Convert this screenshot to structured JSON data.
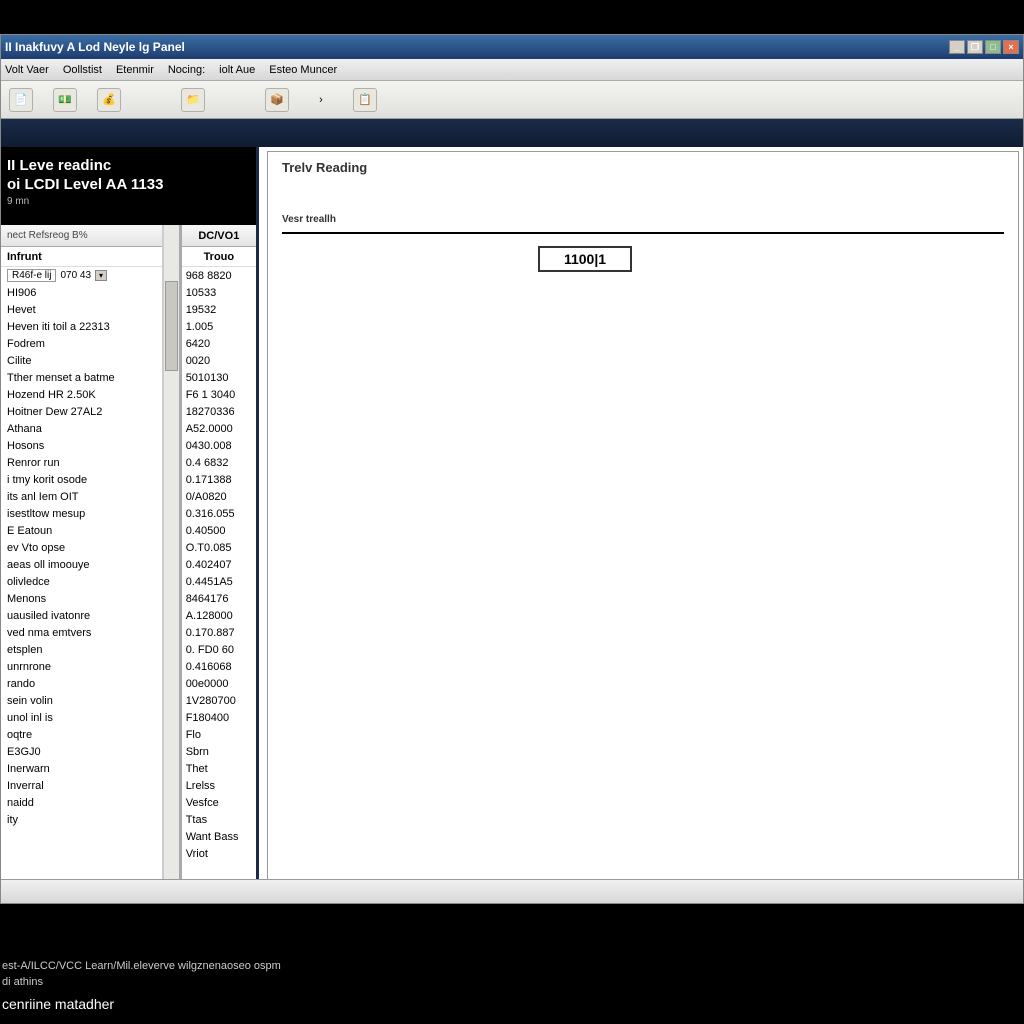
{
  "window": {
    "title": "II Inakfuvy A Lod Neyle lg Panel"
  },
  "menu": {
    "items": [
      "Volt Vaer",
      "Oollstist",
      "Etenmir",
      "Nocing:",
      "iolt Aue",
      "Esteo Muncer"
    ]
  },
  "toolbar_icons": [
    "doc-icon",
    "money-icon",
    "coins-icon",
    "folder-icon",
    "box-icon",
    "arrow-icon",
    "page-icon"
  ],
  "left": {
    "title1": "II Leve readinc",
    "title2": "oi LCDI Level AA 1133",
    "sub": "9 mn",
    "col1_header": "nect Refsreog B%",
    "col1_subheader": "Infrunt",
    "col2_header": "DC/VO1",
    "col2_subheader": "Trouo",
    "first_row_a": "R46f-e lij",
    "first_row_b": "070 43",
    "rows1": [
      "HI906",
      "Hevet",
      "Heven iti toil a 22313",
      "Fodrem",
      "Cilite",
      "Tther menset a batme",
      "Hozend HR 2.50K",
      "Hoitner Dew  27AL2",
      "Athana",
      "Hosons",
      "Renror run",
      "i tmy korit osode",
      "its anl Iem OIT",
      "isestltow mesup",
      "E  Eatoun",
      "ev Vto opse",
      "aeas oll imoouye",
      "olivledce",
      "Menons",
      "uausiled ivatonre",
      "ved nma emtvers",
      "etsplen",
      "unrnrone",
      "rando",
      "sein volin",
      "unol inl is",
      "oqtre",
      "E3GJ0",
      "Inerwarn",
      "Inverral",
      "naidd",
      "ity"
    ],
    "rows2": [
      "968 8820",
      "10533",
      "19532",
      "1.005",
      "6420",
      "0020",
      "5010130",
      "F6 1 3040",
      "18270336",
      "A52.0000",
      "0430.008",
      "0.4 6832",
      "0.171388",
      "0/A0820",
      "0.316.055",
      "0.40500",
      "O.T0.085",
      "0.402407",
      "0.4451A5",
      "8464176",
      "A.128000",
      "0.170.887",
      "0. FD0 60",
      "0.416068",
      "00е0000",
      "1V280700",
      "F180400",
      "Flo",
      "Sbrn",
      "Thet",
      "Lrelss",
      "Vesfce",
      "Ttas",
      "Want Bass",
      "Vriot"
    ]
  },
  "main": {
    "title": "Trelv Reading",
    "sub": "Vesr treallh",
    "box_value": "1100|1"
  },
  "bottom": {
    "line1": "est-A/ILCC/VCC Learn/Mil.eleverve wilgznenaoseo ospm",
    "line2": "di athins",
    "line3": "cenriine matadher"
  }
}
